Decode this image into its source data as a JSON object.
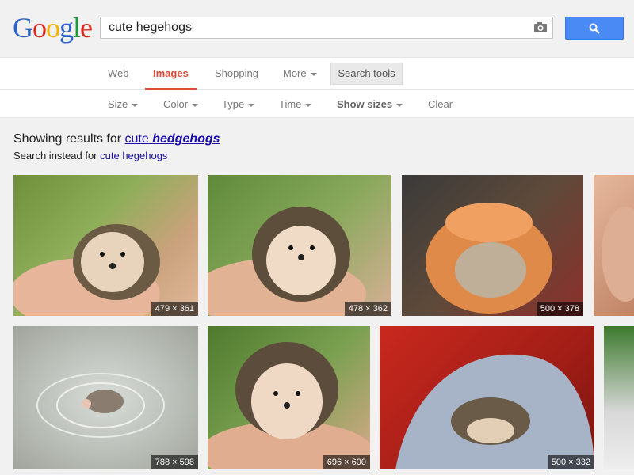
{
  "logo": {
    "text": "Google"
  },
  "search": {
    "value": "cute hegehogs",
    "camera_icon": "camera-icon",
    "search_icon": "search-icon"
  },
  "tabs": {
    "web": "Web",
    "images": "Images",
    "shopping": "Shopping",
    "more": "More",
    "search_tools": "Search tools"
  },
  "tools": {
    "size": "Size",
    "color": "Color",
    "type": "Type",
    "time": "Time",
    "show_sizes": "Show sizes",
    "clear": "Clear"
  },
  "results": {
    "showing_prefix": "Showing results for",
    "corrected_plain": "cute",
    "corrected_bold": "hedgehogs",
    "instead_prefix": "Search instead for",
    "instead_query": "cute hegehogs"
  },
  "images": [
    {
      "dims": "479 × 361"
    },
    {
      "dims": "478 × 362"
    },
    {
      "dims": "500 × 378"
    },
    {
      "dims": ""
    },
    {
      "dims": "788 × 598"
    },
    {
      "dims": "696 × 600"
    },
    {
      "dims": "500 × 332"
    },
    {
      "dims": ""
    }
  ],
  "colors": {
    "accent_red": "#dd4b39",
    "link_blue": "#1a0dab",
    "button_blue": "#4a8af4"
  }
}
